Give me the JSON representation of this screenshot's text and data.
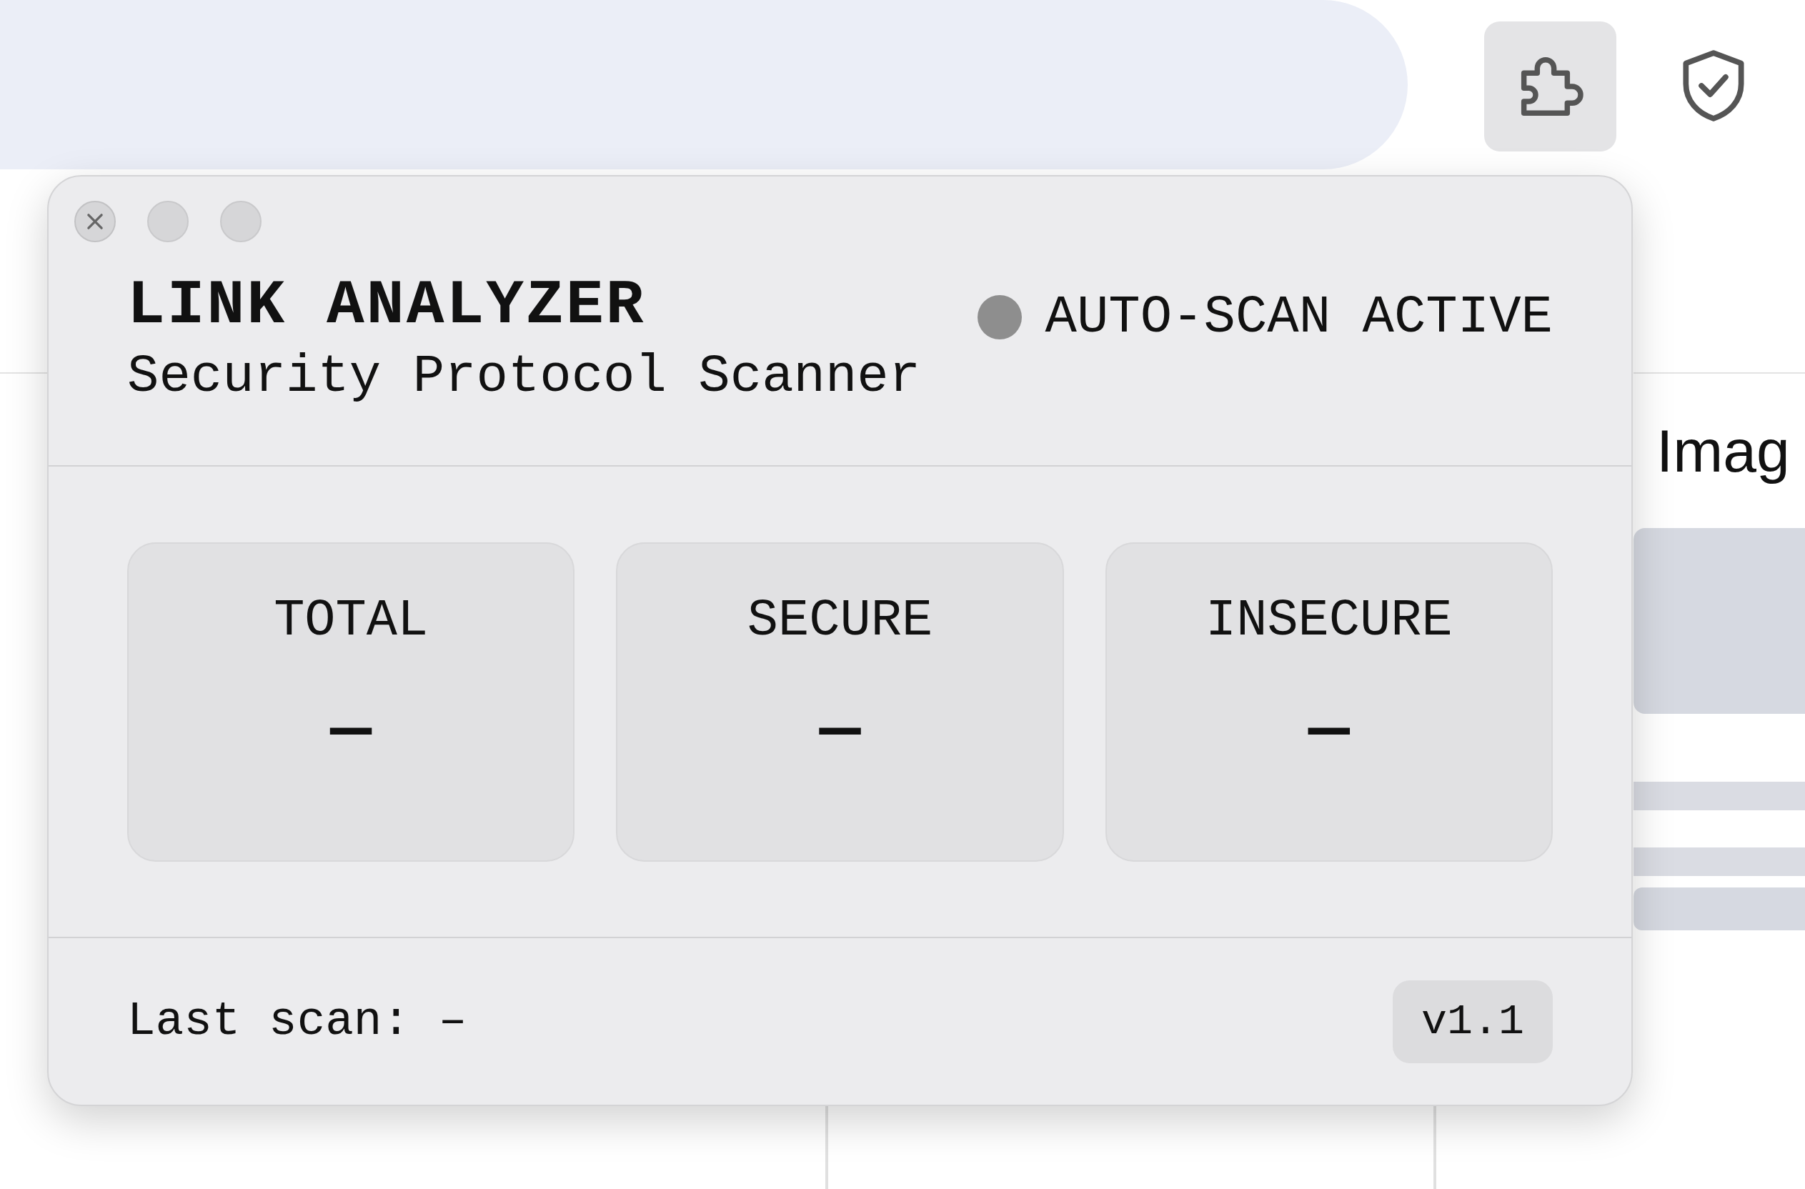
{
  "background": {
    "side_heading": "Imag"
  },
  "popup": {
    "title": "LINK ANALYZER",
    "subtitle": "Security Protocol Scanner",
    "status": {
      "label": "AUTO-SCAN ACTIVE",
      "color": "#8e8e8e"
    },
    "stats": [
      {
        "label": "TOTAL",
        "value": "—"
      },
      {
        "label": "SECURE",
        "value": "—"
      },
      {
        "label": "INSECURE",
        "value": "—"
      }
    ],
    "footer": {
      "last_scan": "Last scan: –",
      "version": "v1.1"
    }
  }
}
